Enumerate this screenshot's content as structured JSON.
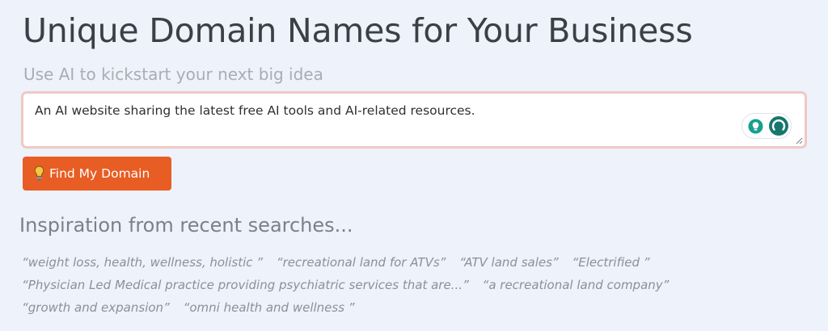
{
  "header": {
    "title": "Unique Domain Names for Your Business",
    "subtitle": "Use AI to kickstart your next big idea"
  },
  "search": {
    "value": "An AI website sharing the latest free AI tools and AI-related resources.",
    "tools": [
      "lightbulb-icon",
      "grammar-check-icon"
    ]
  },
  "actions": {
    "find_label": "Find My Domain",
    "find_icon": "lightbulb-icon"
  },
  "recent": {
    "title": "Inspiration from recent searches...",
    "items": [
      "“weight loss, health, wellness, holistic ”",
      "“recreational land for ATVs”",
      "“ATV land sales”",
      "“Electrified ”",
      "“Physician Led Medical practice providing psychiatric services that are...”",
      "“a recreational land company”",
      "“growth and expansion”",
      "“omni health and wellness ”"
    ]
  },
  "colors": {
    "background": "#edf2fb",
    "accent": "#e85d24",
    "input_border": "#f0c9c3",
    "tool_green": "#17776c"
  }
}
